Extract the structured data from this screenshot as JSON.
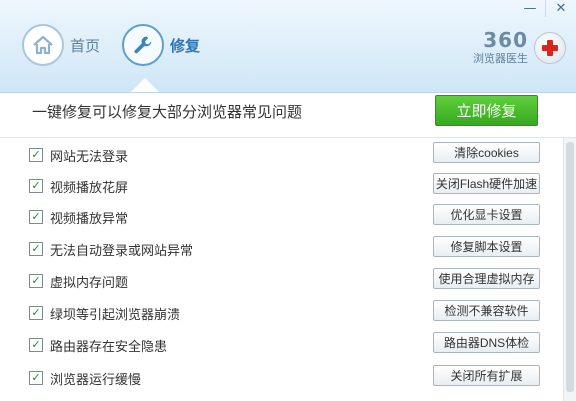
{
  "window": {
    "minimize_glyph": "—",
    "close_glyph": "✕"
  },
  "nav": {
    "tabs": [
      {
        "label": "首页",
        "icon": "home-icon",
        "active": false
      },
      {
        "label": "修复",
        "icon": "wrench-icon",
        "active": true
      }
    ]
  },
  "brand": {
    "number": "360",
    "name": "浏览器医生",
    "logo_icon": "medical-cross-icon"
  },
  "top_bar": {
    "headline": "一键修复可以修复大部分浏览器常见问题",
    "repair_now_label": "立即修复"
  },
  "items": [
    {
      "label": "网站无法登录",
      "button": "清除cookies",
      "checked": true
    },
    {
      "label": "视频播放花屏",
      "button": "关闭Flash硬件加速",
      "checked": true
    },
    {
      "label": "视频播放异常",
      "button": "优化显卡设置",
      "checked": true
    },
    {
      "label": "无法自动登录或网站异常",
      "button": "修复脚本设置",
      "checked": true
    },
    {
      "label": "虚拟内存问题",
      "button": "使用合理虚拟内存",
      "checked": true
    },
    {
      "label": "绿坝等引起浏览器崩溃",
      "button": "检测不兼容软件",
      "checked": true
    },
    {
      "label": "路由器存在安全隐患",
      "button": "路由器DNS体检",
      "checked": true
    },
    {
      "label": "浏览器运行缓慢",
      "button": "关闭所有扩展",
      "checked": true
    }
  ],
  "check_glyph": "✓",
  "colors": {
    "accent_blue": "#2f77b4",
    "repair_green": "#36a91f",
    "logo_red": "#d9251c"
  }
}
